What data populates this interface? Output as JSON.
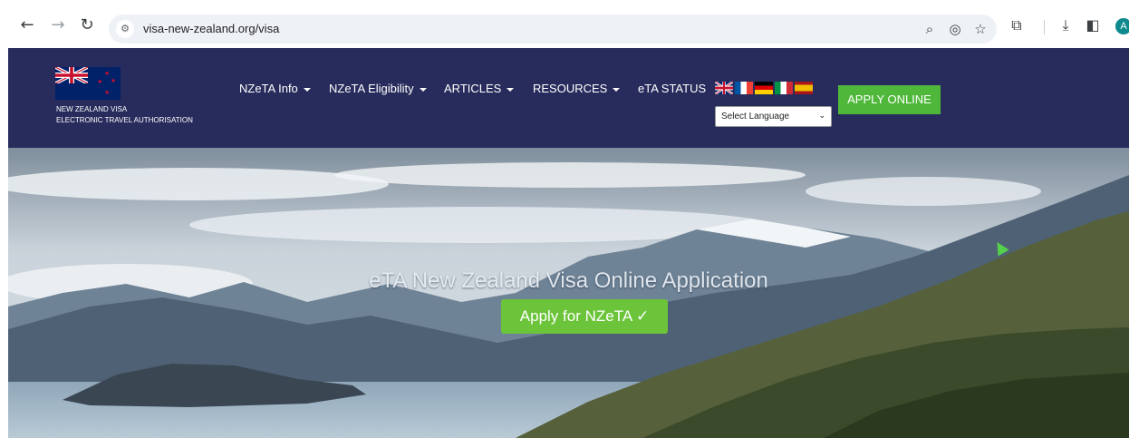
{
  "browser": {
    "url": "visa-new-zealand.org/visa",
    "profile_initial": "A",
    "nav_icons": [
      "back-icon",
      "forward-icon",
      "reload-icon"
    ],
    "omnibox_icons": [
      "site-settings-icon",
      "zoom-icon",
      "tracking-protection-icon",
      "bookmark-star-icon"
    ],
    "toolbar_icons": [
      "extensions-icon",
      "downloads-icon",
      "side-panel-icon"
    ]
  },
  "site_header": {
    "logo_line1": "NEW ZEALAND VISA",
    "logo_line2": "ELECTRONIC TRAVEL AUTHORISATION",
    "menu": [
      {
        "label": "NZeTA Info",
        "dropdown": true
      },
      {
        "label": "NZeTA Eligibility",
        "dropdown": true
      },
      {
        "label": "ARTICLES",
        "dropdown": true
      },
      {
        "label": "RESOURCES",
        "dropdown": true
      },
      {
        "label": "eTA STATUS",
        "dropdown": false
      }
    ],
    "language_flags": [
      "uk-flag-icon",
      "france-flag-icon",
      "germany-flag-icon",
      "italy-flag-icon",
      "spain-flag-icon"
    ],
    "language_select": "Select Language",
    "apply_online": "APPLY ONLINE",
    "colors": {
      "background": "#282c5c",
      "apply_button": "#4fb83a"
    }
  },
  "hero": {
    "title": "eTA New Zealand Visa Online Application",
    "button_label": "Apply for NZeTA",
    "button_icon": "checkmark-icon",
    "colors": {
      "button": "#6cc43a"
    }
  }
}
